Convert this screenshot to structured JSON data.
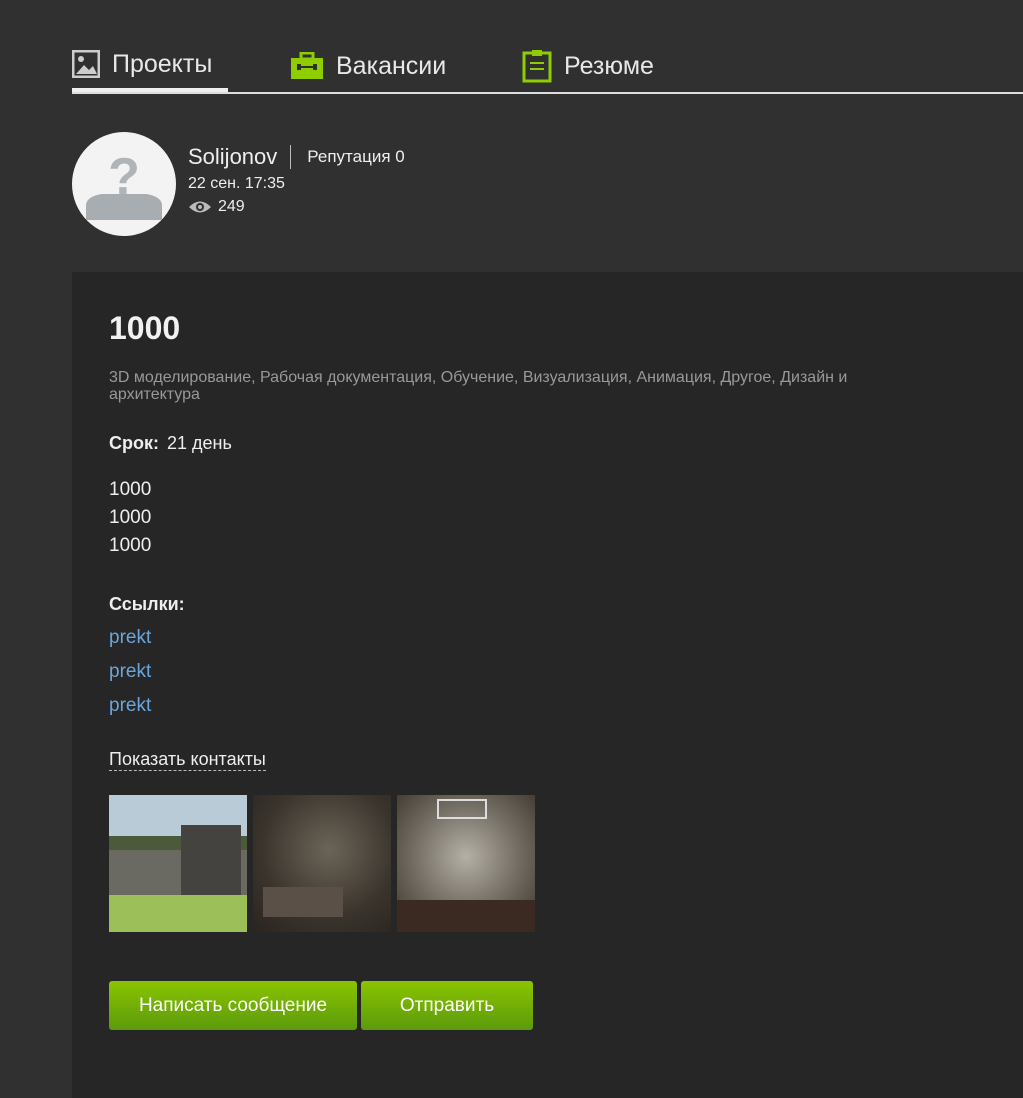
{
  "tabs": [
    {
      "label": "Проекты",
      "icon": "image-icon"
    },
    {
      "label": "Вакансии",
      "icon": "briefcase-icon"
    },
    {
      "label": "Резюме",
      "icon": "clipboard-icon"
    }
  ],
  "profile": {
    "name": "Solijonov",
    "reputation": "Репутация 0",
    "date": "22 сен. 17:35",
    "views": "249"
  },
  "project": {
    "title": "1000",
    "categories": "3D моделирование, Рабочая документация, Обучение, Визуализация, Анимация, Другое, Дизайн и архитектура",
    "term_label": "Срок:",
    "term_value": "21 день",
    "description": [
      "1000",
      "1000",
      "1000"
    ],
    "links_label": "Ссылки:",
    "links": [
      "prekt",
      "prekt",
      "prekt"
    ],
    "show_contacts": "Показать контакты"
  },
  "actions": {
    "write_message": "Написать сообщение",
    "send": "Отправить"
  },
  "colors": {
    "accent": "#7ab800",
    "link": "#6aa6dc"
  }
}
